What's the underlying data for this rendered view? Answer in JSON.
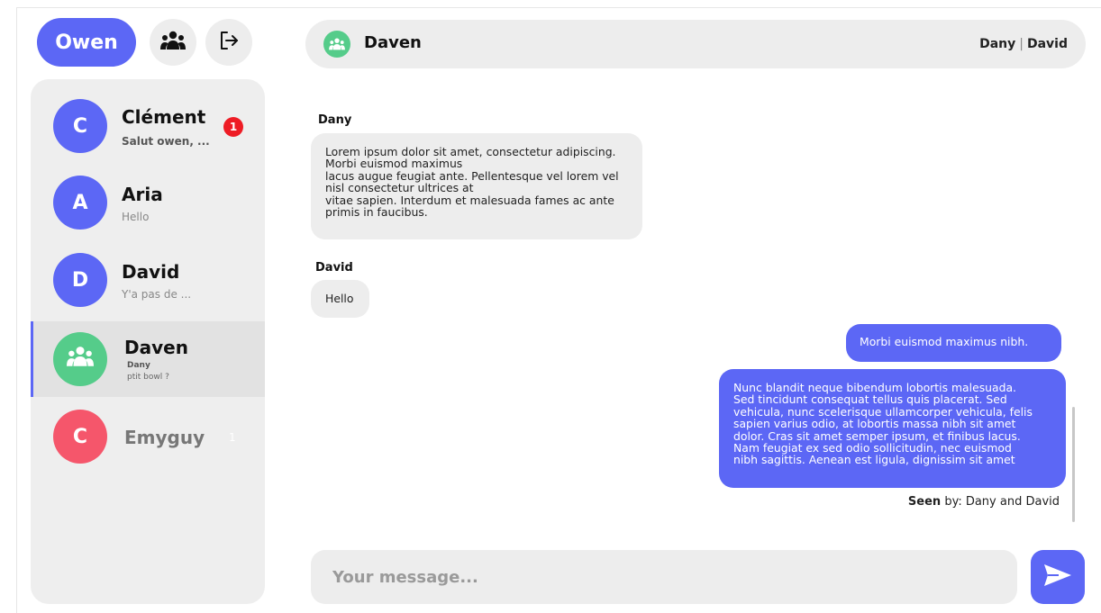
{
  "current_user": {
    "name": "Owen"
  },
  "top_actions": {
    "groups_icon": "group-icon",
    "logout_icon": "logout-icon"
  },
  "conversations": [
    {
      "initial": "C",
      "name": "Clément",
      "preview": "Salut owen, ...",
      "unread": "1",
      "avatar_color": "#5c67f5",
      "unread_bold": true
    },
    {
      "initial": "A",
      "name": "Aria",
      "preview": "Hello",
      "avatar_color": "#5c67f5"
    },
    {
      "initial": "D",
      "name": "David",
      "preview": "Y'a pas de ...",
      "avatar_color": "#5c67f5"
    },
    {
      "name": "Daven",
      "last_sender": "Dany",
      "preview": "ptit bowl ?",
      "avatar_color": "#55cc8a",
      "is_group": true,
      "active": true
    },
    {
      "initial": "C",
      "name": "Emyguy",
      "unread": "1",
      "avatar_color": "#f5566b",
      "muted": true
    }
  ],
  "chat": {
    "title": "Daven",
    "members": [
      "Dany",
      "David"
    ],
    "messages": [
      {
        "sender": "Dany",
        "direction": "in",
        "lines": [
          "Lorem ipsum dolor sit amet, consectetur adipiscing.",
          "Morbi euismod maximus",
          "lacus augue feugiat ante. Pellentesque vel lorem vel",
          "nisl consectetur ultrices at",
          "vitae sapien. Interdum et malesuada fames ac ante",
          "primis in faucibus."
        ]
      },
      {
        "sender": "David",
        "direction": "in",
        "lines": [
          "Hello"
        ]
      },
      {
        "direction": "out",
        "lines": [
          "Morbi euismod maximus nibh."
        ]
      },
      {
        "direction": "out",
        "lines": [
          "Nunc blandit neque bibendum lobortis malesuada.",
          "Sed tincidunt consequat tellus quis placerat. Sed",
          "vehicula, nunc scelerisque ullamcorper vehicula, felis",
          "sapien varius odio, at lobortis massa nibh sit amet",
          "dolor. Cras sit amet semper ipsum, et finibus lacus.",
          "Nam feugiat ex sed odio sollicitudin, nec euismod",
          "nibh sagittis. Aenean est ligula, dignissim sit amet"
        ]
      }
    ],
    "seen": {
      "label": "Seen",
      "text": " by: Dany and David"
    }
  },
  "composer": {
    "placeholder": "Your message...",
    "value": "",
    "send_icon": "send-icon"
  },
  "colors": {
    "accent": "#5c67f5",
    "group": "#55cc8a",
    "red": "#f5566b",
    "badge": "#ee1c25",
    "panel": "#eeeeee"
  }
}
